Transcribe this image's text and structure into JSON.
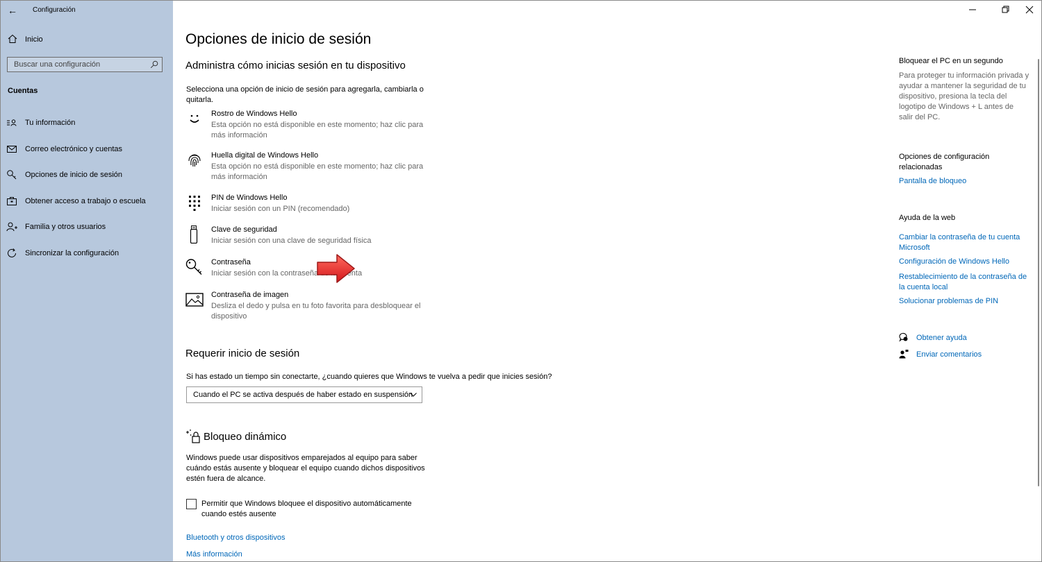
{
  "window": {
    "title": "Configuración",
    "back_glyph": "←",
    "controls": [
      "minimize-icon",
      "restore-icon",
      "close-icon"
    ]
  },
  "sidebar": {
    "home_label": "Inicio",
    "search_placeholder": "Buscar una configuración",
    "section_label": "Cuentas",
    "items": [
      {
        "label": "Tu información",
        "icon": "person-card-icon"
      },
      {
        "label": "Correo electrónico y cuentas",
        "icon": "mail-icon"
      },
      {
        "label": "Opciones de inicio de sesión",
        "icon": "key-icon"
      },
      {
        "label": "Obtener acceso a trabajo o escuela",
        "icon": "briefcase-icon"
      },
      {
        "label": "Familia y otros usuarios",
        "icon": "person-add-icon"
      },
      {
        "label": "Sincronizar la configuración",
        "icon": "sync-icon"
      }
    ]
  },
  "main": {
    "title": "Opciones de inicio de sesión",
    "subtitle": "Administra cómo inicias sesión en tu dispositivo",
    "intro_line1": "Selecciona una opción de inicio de sesión para agregarla, cambiarla o",
    "intro_line2": "quitarla.",
    "options": [
      {
        "title": "Rostro de Windows Hello",
        "desc_line1": "Esta opción no está disponible en este momento; haz clic para",
        "desc_line2": "más información",
        "icon": "face-icon"
      },
      {
        "title": "Huella digital de Windows Hello",
        "desc_line1": "Esta opción no está disponible en este momento; haz clic para",
        "desc_line2": "más información",
        "icon": "fingerprint-icon"
      },
      {
        "title": "PIN de Windows Hello",
        "desc_line1": "Iniciar sesión con un PIN (recomendado)",
        "desc_line2": "",
        "icon": "pin-keypad-icon"
      },
      {
        "title": "Clave de seguridad",
        "desc_line1": "Iniciar sesión con una clave de seguridad física",
        "desc_line2": "",
        "icon": "usb-key-icon"
      },
      {
        "title": "Contraseña",
        "desc_line1": "Iniciar sesión con la contraseña de la cuenta",
        "desc_line2": "",
        "icon": "password-key-icon"
      },
      {
        "title": "Contraseña de imagen",
        "desc_line1": "Desliza el dedo y pulsa en tu foto favorita para desbloquear el",
        "desc_line2": "dispositivo",
        "icon": "picture-icon"
      }
    ],
    "require_heading": "Requerir inicio de sesión",
    "require_text": "Si has estado un tiempo sin conectarte, ¿cuando quieres que Windows te vuelva a pedir que inicies sesión?",
    "require_dropdown": "Cuando el PC se activa después de haber estado en suspensión",
    "dynamic_heading": "Bloqueo dinámico",
    "dynamic_line1": "Windows puede usar dispositivos emparejados al equipo para saber",
    "dynamic_line2": "cuándo estás ausente y bloquear el equipo cuando dichos dispositivos",
    "dynamic_line3": "estén fuera de alcance.",
    "checkbox_line1": "Permitir que Windows bloquee el dispositivo automáticamente",
    "checkbox_line2": "cuando estés ausente",
    "checkbox_checked": false,
    "link_bluetooth": "Bluetooth y otros dispositivos",
    "link_more_info": "Más información"
  },
  "right_panel": {
    "lock_heading": "Bloquear el PC en un segundo",
    "lock_lines": [
      "Para proteger tu información privada y",
      "ayudar a mantener la seguridad de tu",
      "dispositivo, presiona la tecla del",
      "logotipo de Windows + L antes de",
      "salir del PC."
    ],
    "related_heading_1": "Opciones de configuración",
    "related_heading_2": "relacionadas",
    "related_link": "Pantalla de bloqueo",
    "web_heading": "Ayuda de la web",
    "web_link_1a": "Cambiar la contraseña de tu cuenta",
    "web_link_1b": "Microsoft",
    "web_link_2": "Configuración de Windows Hello",
    "web_link_3a": "Restablecimiento de la contraseña de",
    "web_link_3b": "la cuenta local",
    "web_link_4": "Solucionar problemas de PIN",
    "help_link": "Obtener ayuda",
    "feedback_link": "Enviar comentarios"
  },
  "colors": {
    "sidebar_bg": "#b7c8dd",
    "link": "#0067b8",
    "annotation_arrow": "#e8312f"
  }
}
